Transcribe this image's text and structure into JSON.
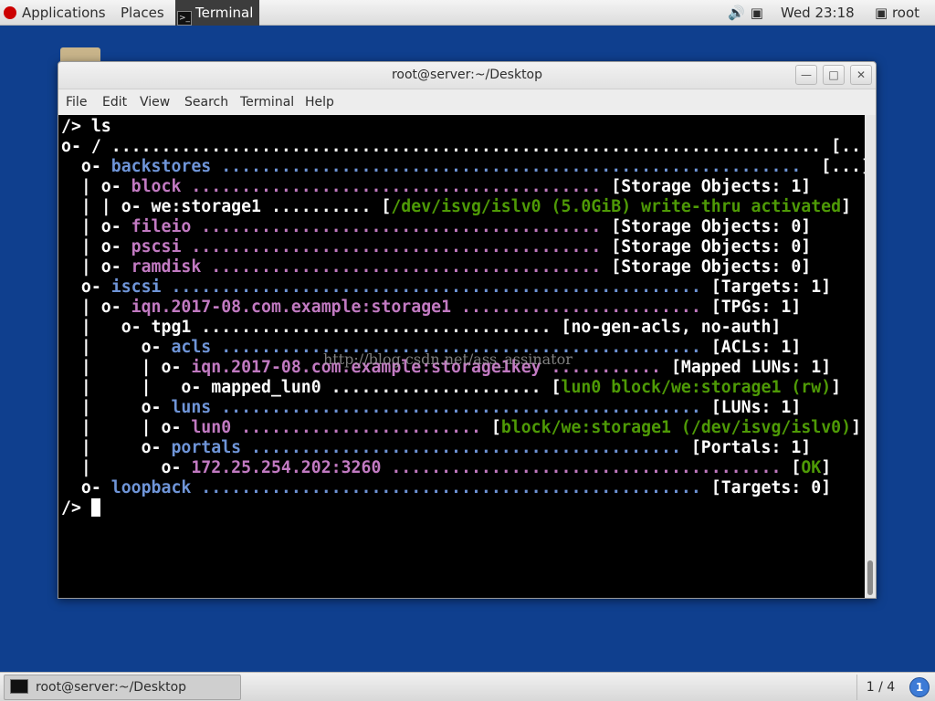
{
  "topbar": {
    "applications": "Applications",
    "places": "Places",
    "terminal_app": "Terminal",
    "clock": "Wed 23:18",
    "user": "root",
    "icons": [
      "volume-icon",
      "network-icon",
      "user-icon"
    ]
  },
  "window": {
    "title": "root@server:~/Desktop",
    "menu": [
      "File",
      "Edit",
      "View",
      "Search",
      "Terminal",
      "Help"
    ]
  },
  "terminal": {
    "lines": [
      [
        [
          "/> ls",
          "w"
        ]
      ],
      [
        [
          "o- / ",
          "w"
        ],
        [
          "....................................................................... ",
          "w"
        ],
        [
          "[...]",
          "w"
        ]
      ],
      [
        [
          "  o- ",
          "w"
        ],
        [
          "backstores",
          "b"
        ],
        [
          " ..........................................................  ",
          "b"
        ],
        [
          "[...]",
          "w"
        ]
      ],
      [
        [
          "  | o- ",
          "w"
        ],
        [
          "block",
          "m"
        ],
        [
          " ......................................... ",
          "m"
        ],
        [
          "[Storage Objects: 1]",
          "w"
        ]
      ],
      [
        [
          "  | | o- we:storage1 .......... [",
          "w"
        ],
        [
          "/dev/isvg/islv0 (5.0GiB) write-thru activated",
          "g"
        ],
        [
          "]",
          "w"
        ]
      ],
      [
        [
          "  | o- ",
          "w"
        ],
        [
          "fileio",
          "m"
        ],
        [
          " ........................................ ",
          "m"
        ],
        [
          "[Storage Objects: 0]",
          "w"
        ]
      ],
      [
        [
          "  | o- ",
          "w"
        ],
        [
          "pscsi",
          "m"
        ],
        [
          " ......................................... ",
          "m"
        ],
        [
          "[Storage Objects: 0]",
          "w"
        ]
      ],
      [
        [
          "  | o- ",
          "w"
        ],
        [
          "ramdisk",
          "m"
        ],
        [
          " ....................................... ",
          "m"
        ],
        [
          "[Storage Objects: 0]",
          "w"
        ]
      ],
      [
        [
          "  o- ",
          "w"
        ],
        [
          "iscsi",
          "b"
        ],
        [
          " ..................................................... ",
          "b"
        ],
        [
          "[Targets: 1]",
          "w"
        ]
      ],
      [
        [
          "  | o- ",
          "w"
        ],
        [
          "iqn.2017-08.com.example:storage1",
          "m"
        ],
        [
          " ........................ ",
          "m"
        ],
        [
          "[TPGs: 1]",
          "w"
        ]
      ],
      [
        [
          "  |   o- tpg1 ................................... [no-gen-acls, no-auth]",
          "w"
        ]
      ],
      [
        [
          "  |     o- ",
          "w"
        ],
        [
          "acls",
          "b"
        ],
        [
          " ................................................ ",
          "b"
        ],
        [
          "[ACLs: 1]",
          "w"
        ]
      ],
      [
        [
          "  |     | o- ",
          "w"
        ],
        [
          "iqn.2017-08.com.example:storage1key",
          "m"
        ],
        [
          " ........... ",
          "m"
        ],
        [
          "[Mapped LUNs: 1]",
          "w"
        ]
      ],
      [
        [
          "  |     |   o- mapped_lun0 ..................... [",
          "w"
        ],
        [
          "lun0 block/we:storage1 (rw)",
          "g"
        ],
        [
          "]",
          "w"
        ]
      ],
      [
        [
          "  |     o- ",
          "w"
        ],
        [
          "luns",
          "b"
        ],
        [
          " ................................................ ",
          "b"
        ],
        [
          "[LUNs: 1]",
          "w"
        ]
      ],
      [
        [
          "  |     | o- ",
          "w"
        ],
        [
          "lun0",
          "m"
        ],
        [
          " ........................ ",
          "m"
        ],
        [
          "[",
          "w"
        ],
        [
          "block/we:storage1 (/dev/isvg/islv0)",
          "g"
        ],
        [
          "]",
          "w"
        ]
      ],
      [
        [
          "  |     o- ",
          "w"
        ],
        [
          "portals",
          "b"
        ],
        [
          " ........................................... ",
          "b"
        ],
        [
          "[Portals: 1]",
          "w"
        ]
      ],
      [
        [
          "  |       o- ",
          "w"
        ],
        [
          "172.25.254.202:3260",
          "m"
        ],
        [
          " ....................................... ",
          "m"
        ],
        [
          "[",
          "w"
        ],
        [
          "OK",
          "g"
        ],
        [
          "]",
          "w"
        ]
      ],
      [
        [
          "  o- ",
          "w"
        ],
        [
          "loopback",
          "b"
        ],
        [
          " .................................................. ",
          "b"
        ],
        [
          "[Targets: 0]",
          "w"
        ]
      ],
      [
        [
          "/> ",
          "w"
        ]
      ]
    ],
    "watermark": "http://blog.csdn.net/ass_assinator"
  },
  "taskbar": {
    "task_label": "root@server:~/Desktop",
    "workspace": "1 / 4",
    "notify": "1"
  }
}
